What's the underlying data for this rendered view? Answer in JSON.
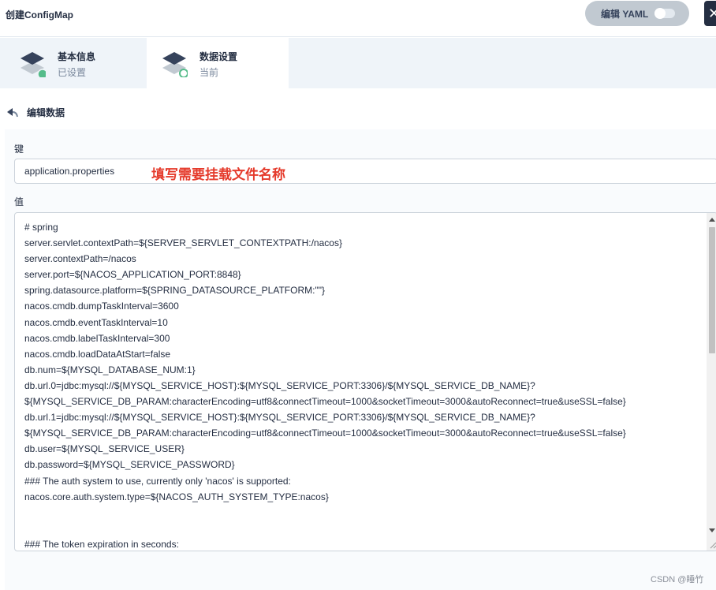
{
  "header": {
    "title": "创建ConfigMap",
    "yaml_button_label": "编辑 YAML",
    "close_label": "✕"
  },
  "steps": [
    {
      "name": "基本信息",
      "status": "已设置"
    },
    {
      "name": "数据设置",
      "status": "当前"
    }
  ],
  "section": {
    "title": "编辑数据"
  },
  "form": {
    "key_label": "键",
    "key_value": "application.properties",
    "key_annotation": "填写需要挂载文件名称",
    "value_label": "值",
    "value_lines": [
      "# spring",
      "server.servlet.contextPath=${SERVER_SERVLET_CONTEXTPATH:/nacos}",
      "server.contextPath=/nacos",
      "server.port=${NACOS_APPLICATION_PORT:8848}",
      "spring.datasource.platform=${SPRING_DATASOURCE_PLATFORM:\"\"}",
      "nacos.cmdb.dumpTaskInterval=3600",
      "nacos.cmdb.eventTaskInterval=10",
      "nacos.cmdb.labelTaskInterval=300",
      "nacos.cmdb.loadDataAtStart=false",
      "db.num=${MYSQL_DATABASE_NUM:1}",
      "db.url.0=jdbc:mysql://${MYSQL_SERVICE_HOST}:${MYSQL_SERVICE_PORT:3306}/${MYSQL_SERVICE_DB_NAME}?",
      "${MYSQL_SERVICE_DB_PARAM:characterEncoding=utf8&connectTimeout=1000&socketTimeout=3000&autoReconnect=true&useSSL=false}",
      "db.url.1=jdbc:mysql://${MYSQL_SERVICE_HOST}:${MYSQL_SERVICE_PORT:3306}/${MYSQL_SERVICE_DB_NAME}?",
      "${MYSQL_SERVICE_DB_PARAM:characterEncoding=utf8&connectTimeout=1000&socketTimeout=3000&autoReconnect=true&useSSL=false}",
      "db.user=${MYSQL_SERVICE_USER}",
      "db.password=${MYSQL_SERVICE_PASSWORD}",
      "### The auth system to use, currently only 'nacos' is supported:",
      "nacos.core.auth.system.type=${NACOS_AUTH_SYSTEM_TYPE:nacos}",
      "",
      "",
      "### The token expiration in seconds:"
    ]
  },
  "watermark": "CSDN @睡竹",
  "colors": {
    "accent_green": "#55bc8a",
    "annotation_red": "#e53b2c",
    "dark": "#242e42"
  }
}
